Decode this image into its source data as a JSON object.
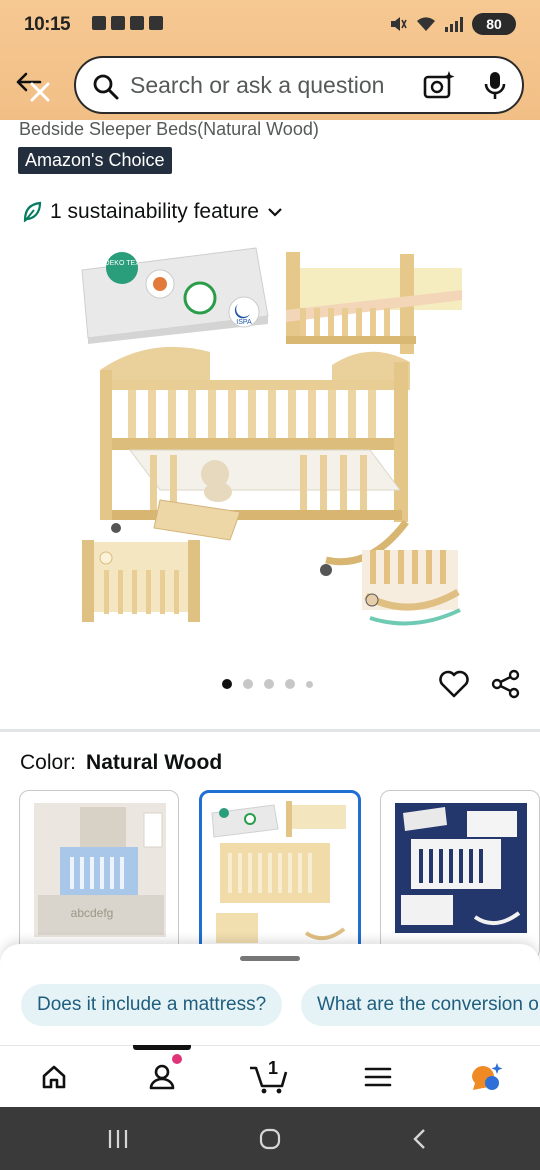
{
  "status_bar": {
    "time": "10:15",
    "battery": "80"
  },
  "search": {
    "placeholder": "Search or ask a question"
  },
  "product": {
    "title_fragment": "Bedside Sleeper Beds(Natural Wood)",
    "badge": "Amazon's Choice",
    "sustainability": "1 sustainability feature",
    "image_labels": {
      "oeko": "OEKO TEX",
      "ispa": "ISPA"
    },
    "carousel": {
      "count": 5,
      "active": 1
    }
  },
  "color": {
    "label": "Color:",
    "value": "Natural Wood",
    "swatches": [
      {
        "name": "Light Blue"
      },
      {
        "name": "Natural Wood",
        "selected": true
      },
      {
        "name": "White"
      }
    ]
  },
  "questions": {
    "chips": [
      "Does it include a mattress?",
      "What are the conversion options?"
    ]
  },
  "bottom_nav": {
    "cart_count": "1"
  },
  "colors": {
    "header_bg": "#f3c48c",
    "badge_bg": "#232f3e",
    "selected_border": "#1f6ed1",
    "chip_bg": "#e6f3f6",
    "chip_text": "#1f5e7e",
    "sustainability_green": "#067d62"
  }
}
